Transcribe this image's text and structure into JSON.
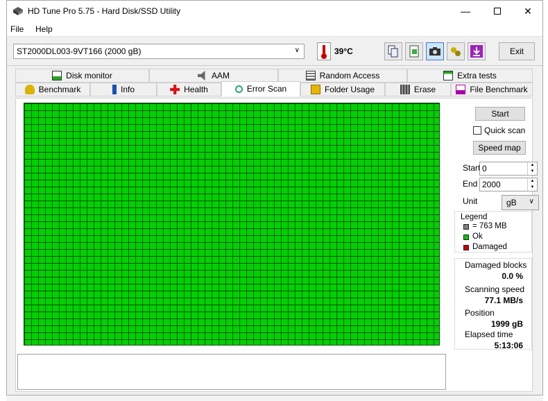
{
  "window": {
    "title": "HD Tune Pro 5.75 - Hard Disk/SSD Utility"
  },
  "menu": {
    "file": "File",
    "help": "Help"
  },
  "toolbar": {
    "drive": "ST2000DL003-9VT166 (2000 gB)",
    "temperature": "39°C",
    "exit_label": "Exit",
    "icons": [
      "copy-info-icon",
      "copy-clipboard-icon",
      "screenshot-icon",
      "options-icon",
      "save-icon"
    ]
  },
  "tabs": {
    "row1": [
      "Disk monitor",
      "AAM",
      "Random Access",
      "Extra tests"
    ],
    "row2": [
      "Benchmark",
      "Info",
      "Health",
      "Error Scan",
      "Folder Usage",
      "Erase",
      "File Benchmark"
    ],
    "active": "Error Scan"
  },
  "controls": {
    "start_button": "Start",
    "quick_scan": "Quick scan",
    "quick_scan_checked": false,
    "speed_map_button": "Speed map",
    "start_label": "Start",
    "start_value": "0",
    "end_label": "End",
    "end_value": "2000",
    "unit_label": "Unit",
    "unit_value": "gB"
  },
  "legend": {
    "title": "Legend",
    "block": "= 763 MB",
    "ok": "Ok",
    "damaged": "Damaged",
    "colors": {
      "block": "#808080",
      "ok": "#00c800",
      "damaged": "#d00000"
    }
  },
  "stats": {
    "damaged_blocks_label": "Damaged blocks",
    "damaged_blocks_value": "0.0 %",
    "scanning_speed_label": "Scanning speed",
    "scanning_speed_value": "77.1 MB/s",
    "position_label": "Position",
    "position_value": "1999 gB",
    "elapsed_label": "Elapsed time",
    "elapsed_value": "5:13:06"
  },
  "scan_grid": {
    "status": "all blocks ok",
    "color": "#00d100"
  }
}
